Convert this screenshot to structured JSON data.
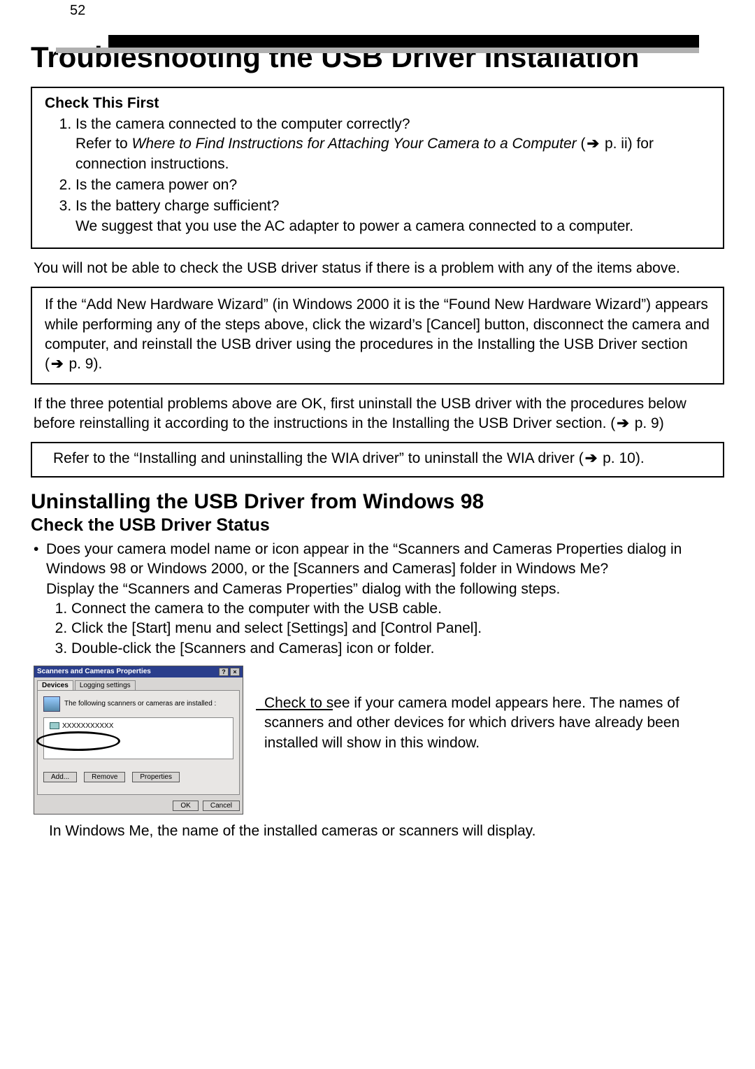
{
  "page_number": "52",
  "title": "Troubleshooting the USB Driver Installation",
  "check_first": {
    "heading": "Check This First",
    "items": [
      {
        "q": "Is the camera connected to the computer correctly?",
        "refer_pre": "Refer to ",
        "refer_italic": "Where to Find Instructions for Attaching Your Camera to a Computer",
        "refer_post": " ( p. ii) for connection instructions."
      },
      {
        "q": "Is the camera power on?"
      },
      {
        "q": "Is the battery charge sufficient?",
        "note": "We suggest that you use the AC adapter to power a camera connected to a computer."
      }
    ]
  },
  "para1": "You will not be able to check the USB driver status if there is a problem with any of the items above.",
  "box2": "If the “Add New Hardware Wizard” (in Windows 2000 it is the “Found New Hardware Wizard”) appears while performing any of the steps above, click the wizard’s [Cancel] button, disconnect the camera and computer, and reinstall the USB driver using the procedures in the Installing the USB Driver section ( p. 9).",
  "para2": "If the three potential problems above are OK, first uninstall the USB driver with the procedures below before reinstalling it according to the instructions in the Installing the USB Driver section. ( p. 9)",
  "box3": "Refer to the “Installing and uninstalling the WIA driver” to uninstall the WIA driver ( p. 10).",
  "h2": "Uninstalling the USB Driver from Windows 98",
  "h3": "Check the USB Driver Status",
  "bullet": "Does your camera model name or icon appear in the “Scanners and Cameras Properties dialog in Windows 98 or Windows 2000, or the [Scanners and Cameras] folder in Windows Me?",
  "bullet_sub": "Display the “Scanners and Cameras Properties” dialog with the following steps.",
  "steps": [
    "Connect the camera to the computer with the USB cable.",
    "Click the [Start] menu and select [Settings] and [Control Panel].",
    "Double-click the [Scanners and Cameras] icon or folder."
  ],
  "dialog": {
    "title": "Scanners and Cameras Properties",
    "help": "?",
    "close": "×",
    "tab_devices": "Devices",
    "tab_logging": "Logging settings",
    "body_text": "The following scanners or cameras are installed :",
    "list_item": "XXXXXXXXXXX",
    "btn_add": "Add...",
    "btn_remove": "Remove",
    "btn_props": "Properties",
    "btn_ok": "OK",
    "btn_cancel": "Cancel"
  },
  "fig_caption": "Check to see if your camera model appears here. The names of scanners and other devices for which drivers have already been installed will show in this window.",
  "bottom": "In Windows Me, the name of the installed cameras or scanners will display."
}
